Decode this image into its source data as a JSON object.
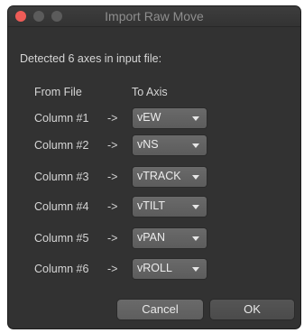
{
  "window": {
    "title": "Import Raw Move"
  },
  "detected_text": "Detected 6 axes in input file:",
  "headers": {
    "from": "From File",
    "to": "To Axis"
  },
  "rows": [
    {
      "from": "Column #1",
      "arrow": "->",
      "to": "vEW"
    },
    {
      "from": "Column #2",
      "arrow": "->",
      "to": "vNS"
    },
    {
      "from": "Column #3",
      "arrow": "->",
      "to": "vTRACK"
    },
    {
      "from": "Column #4",
      "arrow": "->",
      "to": "vTILT"
    },
    {
      "from": "Column #5",
      "arrow": "->",
      "to": "vPAN"
    },
    {
      "from": "Column #6",
      "arrow": "->",
      "to": "vROLL"
    }
  ],
  "buttons": {
    "cancel": "Cancel",
    "ok": "OK"
  },
  "colors": {
    "window_bg": "#323232",
    "close_button": "#ee5c57",
    "inactive_traffic": "#5b5b5b",
    "text": "#d6d6d6"
  },
  "icons": {
    "dropdown": "chevron-down-icon"
  }
}
